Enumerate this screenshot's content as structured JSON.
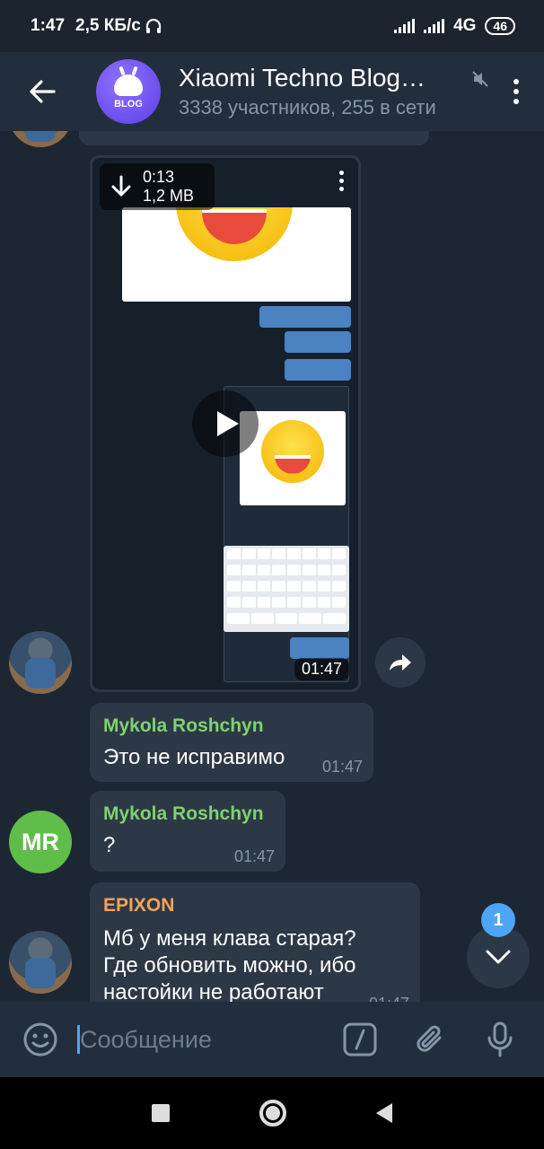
{
  "status_bar": {
    "time": "1:47",
    "speed": "2,5 КБ/с",
    "network": "4G",
    "battery": "46"
  },
  "header": {
    "title": "Xiaomi Techno Blog…",
    "subtitle": "3338 участников, 255 в сети",
    "avatar_label": "BLOG"
  },
  "messages": {
    "video": {
      "duration": "0:13",
      "size": "1,2 MB",
      "time": "01:47"
    },
    "m1": {
      "author": "Mykola Roshchyn",
      "text": "Это не исправимо",
      "time": "01:47"
    },
    "m2": {
      "author": "Mykola Roshchyn",
      "text": "?",
      "time": "01:47",
      "avatar_initials": "MR"
    },
    "m3": {
      "author": "EPIXON",
      "line1": "Мб у меня клава старая?",
      "line2": "Где обновить можно,  ибо",
      "line3": "настойки не работают",
      "time": "01:47"
    }
  },
  "unread_badge": "1",
  "input": {
    "placeholder": "Сообщение"
  },
  "icons": {
    "back": "arrow-left-icon",
    "mute": "muted-speaker-icon",
    "menu": "more-vertical-icon",
    "download": "download-icon",
    "play": "play-icon",
    "share": "share-icon",
    "scroll_down": "chevron-down-icon",
    "emoji": "emoji-icon",
    "command": "slash-command-icon",
    "attach": "paperclip-icon",
    "mic": "microphone-icon"
  },
  "colors": {
    "background": "#1d2733",
    "header": "#232e3c",
    "bubble": "#2d3846",
    "accent": "#4ea4f6",
    "name_green": "#7ed36f",
    "name_orange": "#f2a25b"
  }
}
